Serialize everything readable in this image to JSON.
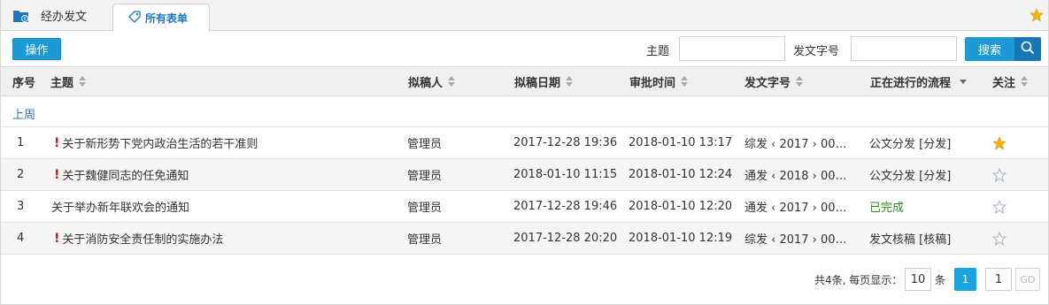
{
  "tabs": {
    "tab1_label": "经办发文",
    "tab2_label": "所有表单"
  },
  "toolbar": {
    "operate_label": "操作",
    "subject_label": "主题",
    "subject_value": "",
    "docno_label": "发文字号",
    "docno_value": "",
    "search_label": "搜索"
  },
  "table": {
    "columns": {
      "seq": "序号",
      "subject": "主题",
      "drafter": "拟稿人",
      "draft_date": "拟稿日期",
      "approve_time": "审批时间",
      "docno": "发文字号",
      "flow": "正在进行的流程",
      "follow": "关注"
    },
    "group_label": "上周",
    "rows": [
      {
        "seq": "1",
        "subject": "关于新形势下党内政治生活的若干准则",
        "urgent": true,
        "drafter": "管理员",
        "draft_date": "2017-12-28 19:36",
        "approve_time": "2018-01-10 13:17",
        "docno": "综发 ‹ 2017 › 00…",
        "flow": "公文分发 [分发]",
        "followed": true
      },
      {
        "seq": "2",
        "subject": "关于魏健同志的任免通知",
        "urgent": true,
        "drafter": "管理员",
        "draft_date": "2018-01-10 11:15",
        "approve_time": "2018-01-10 12:24",
        "docno": "通发 ‹ 2018 › 00…",
        "flow": "公文分发 [分发]",
        "followed": false
      },
      {
        "seq": "3",
        "subject": "关于举办新年联欢会的通知",
        "urgent": false,
        "drafter": "管理员",
        "draft_date": "2017-12-28 19:46",
        "approve_time": "2018-01-10 12:20",
        "docno": "通发 ‹ 2017 › 00…",
        "flow": "已完成",
        "followed": false
      },
      {
        "seq": "4",
        "subject": "关于消防安全责任制的实施办法",
        "urgent": true,
        "drafter": "管理员",
        "draft_date": "2017-12-28 20:20",
        "approve_time": "2018-01-10 12:19",
        "docno": "综发 ‹ 2017 › 00…",
        "flow": "发文核稿 [核稿]",
        "followed": false
      }
    ]
  },
  "pager": {
    "info": "共4条, 每页显示：",
    "page_size": "10",
    "unit": "条",
    "current_page": "1",
    "goto_value": "1",
    "go_label": "GO"
  },
  "colors": {
    "accent": "#1d9ad6",
    "link": "#1a78c2",
    "urgent": "#d9161c",
    "done": "#2a8a1f",
    "star_on": "#f5b400"
  }
}
